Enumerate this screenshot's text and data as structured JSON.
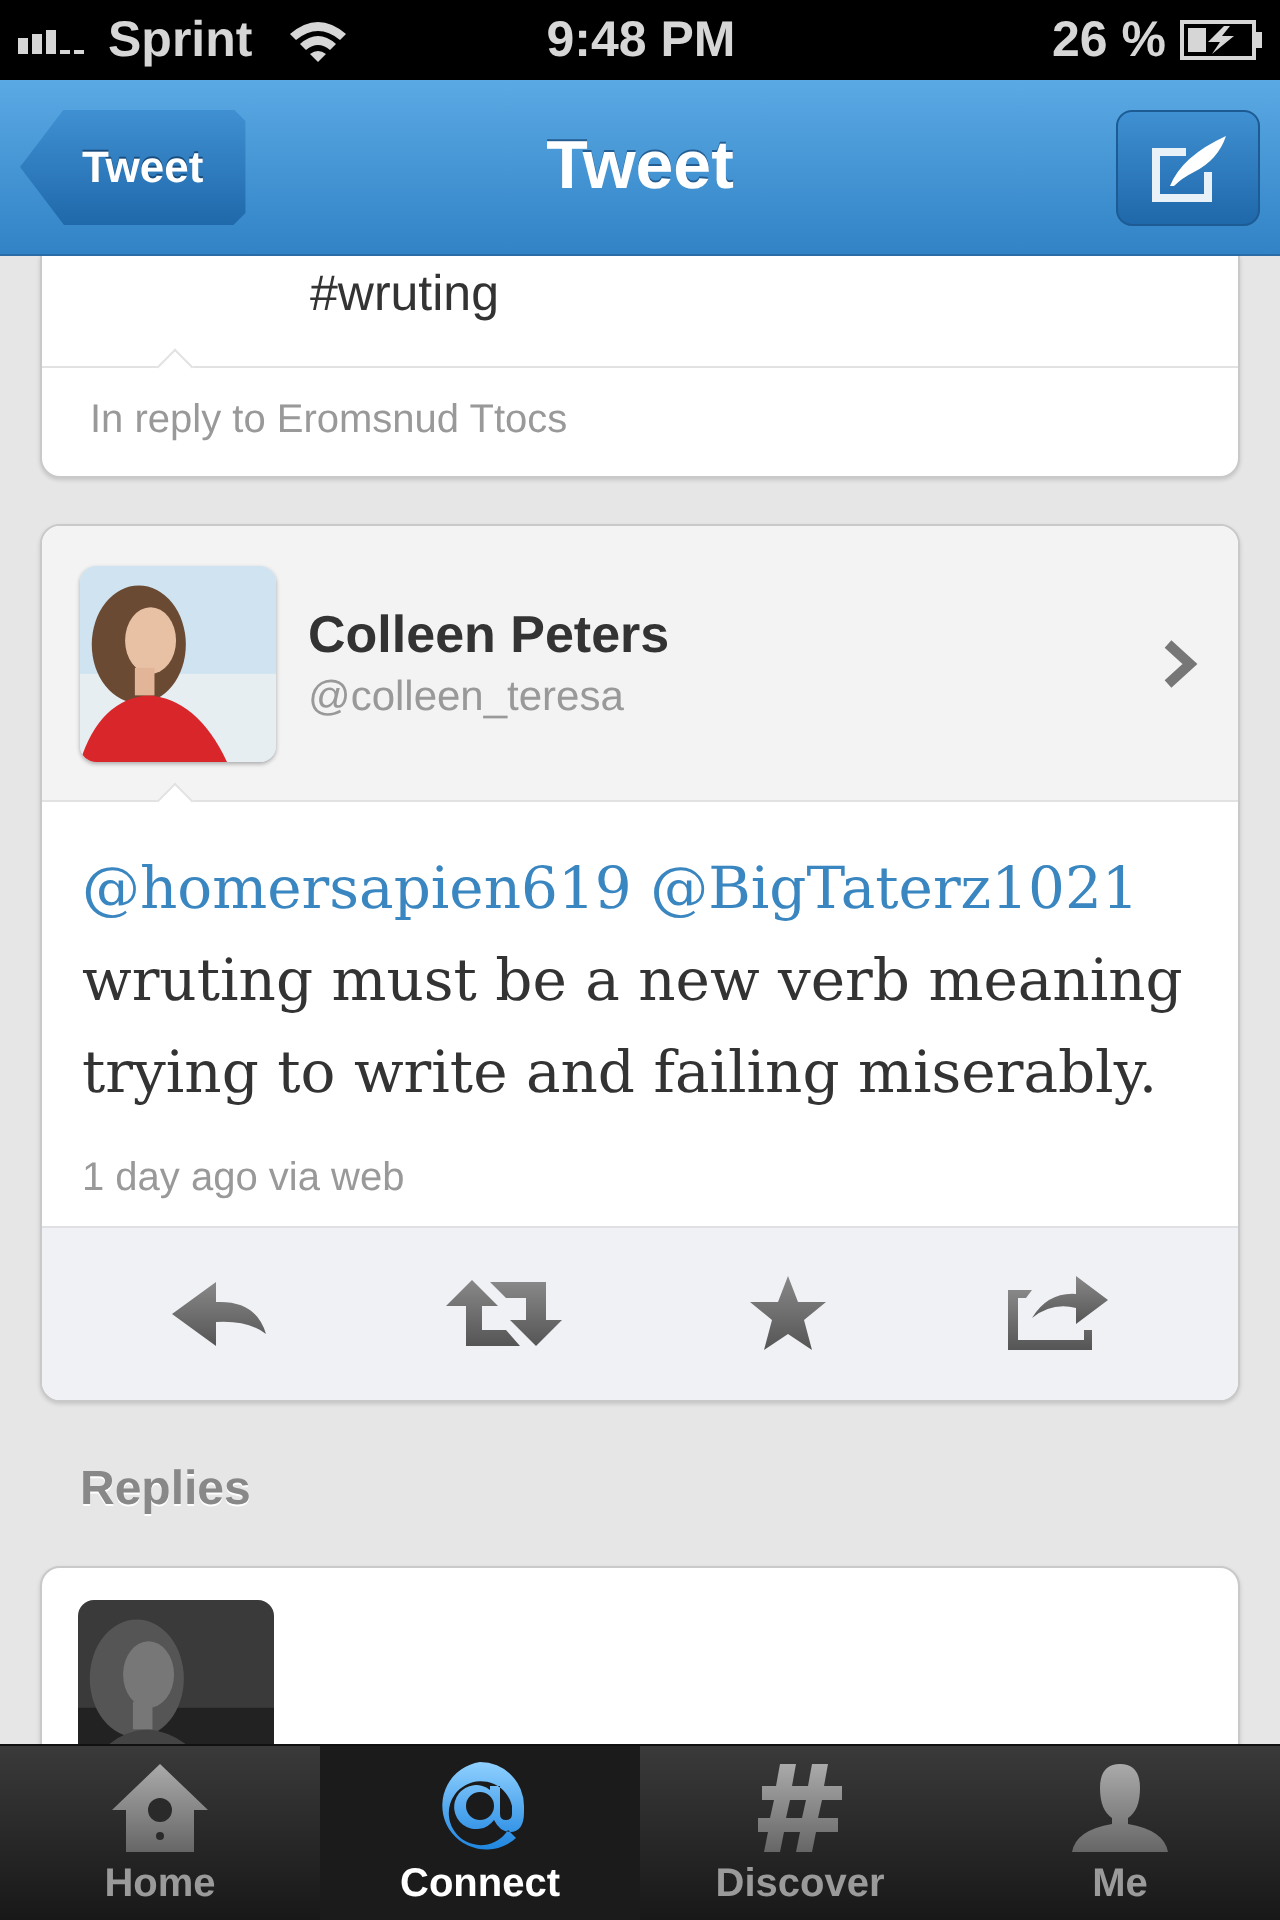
{
  "status_bar": {
    "carrier": "Sprint",
    "time": "9:48 PM",
    "battery": "26 %"
  },
  "nav_bar": {
    "back_button": "Tweet",
    "title": "Tweet"
  },
  "parent_tweet": {
    "text": "#wruting",
    "in_reply_to": "In reply to Eromsnud Ttocs"
  },
  "tweet": {
    "author": "Colleen Peters",
    "handle": "@colleen_teresa",
    "text": [
      {
        "kind": "mention",
        "text": "@homersapien619"
      },
      {
        "kind": "mention",
        "text": "@BigTaterz1021"
      },
      {
        "kind": "plain",
        "text": "wruting must be a new verb meaning trying to write and failing miserably."
      }
    ],
    "meta": "1 day ago via web"
  },
  "replies": {
    "heading": "Replies",
    "items": [
      {
        "kind": "tweet"
      }
    ]
  },
  "tab_bar": [
    {
      "kind": "home",
      "label": "Home",
      "selected": false
    },
    {
      "kind": "connect",
      "label": "Connect",
      "selected": true
    },
    {
      "kind": "discover",
      "label": "Discover",
      "selected": false
    },
    {
      "kind": "me",
      "label": "Me",
      "selected": false
    }
  ]
}
